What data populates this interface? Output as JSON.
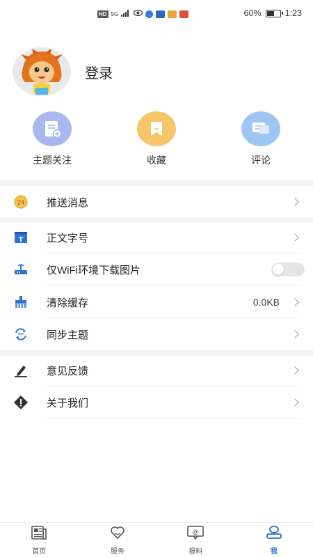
{
  "status_bar": {
    "battery_percent": "60%",
    "battery_level": 0.6,
    "time": "1:23",
    "hd_label": "HD",
    "network_label": "5G"
  },
  "profile": {
    "login_label": "登录"
  },
  "quick_actions": [
    {
      "label": "主题关注",
      "icon": "subscribe-icon",
      "color": "#aab8f0"
    },
    {
      "label": "收藏",
      "icon": "favorite-icon",
      "color": "#f7c56a"
    },
    {
      "label": "评论",
      "icon": "comment-icon",
      "color": "#9fc6f2"
    }
  ],
  "settings": {
    "push": {
      "label": "推送消息",
      "icon": "push-24-icon"
    },
    "font_size": {
      "label": "正文字号",
      "icon": "font-size-icon"
    },
    "wifi_images": {
      "label": "仅WiFi环境下载图片",
      "icon": "router-icon",
      "enabled": false
    },
    "clear_cache": {
      "label": "清除缓存",
      "value": "0.0KB",
      "icon": "brush-icon"
    },
    "sync_topics": {
      "label": "同步主题",
      "icon": "sync-icon"
    },
    "feedback": {
      "label": "意见反馈",
      "icon": "pencil-icon"
    },
    "about": {
      "label": "关于我们",
      "icon": "info-diamond-icon"
    }
  },
  "tabs": [
    {
      "label": "首页",
      "icon": "news-icon",
      "active": false
    },
    {
      "label": "服务",
      "icon": "heart-hands-icon",
      "active": false
    },
    {
      "label": "报料",
      "icon": "report-chat-icon",
      "active": false
    },
    {
      "label": "我",
      "icon": "person-icon",
      "active": true
    }
  ],
  "colors": {
    "accent": "#1f6fd1",
    "divider": "#f4f4f4"
  }
}
